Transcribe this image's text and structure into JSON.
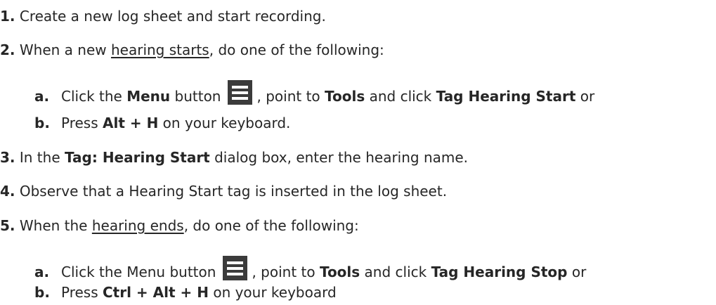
{
  "steps": {
    "s1": {
      "num": "1.",
      "text": " Create a new log sheet and start recording."
    },
    "s2": {
      "num": "2.",
      "pre": " When a new ",
      "link": "hearing starts",
      "post": ", do one of the following:",
      "a": {
        "letter": "a.",
        "t1": "Click the ",
        "b1": "Menu",
        "t2": " button",
        "t3": ", point to ",
        "b2": "Tools",
        "t4": " and click ",
        "b3": "Tag Hearing Start",
        "t5": " or"
      },
      "b": {
        "letter": "b.",
        "t1": "Press ",
        "b1": "Alt + H",
        "t2": " on your keyboard."
      }
    },
    "s3": {
      "num": "3.",
      "pre": " In the ",
      "bold": "Tag: Hearing Start",
      "post": " dialog box, enter the hearing name."
    },
    "s4": {
      "num": "4.",
      "text": " Observe that a Hearing Start tag is inserted in the log sheet."
    },
    "s5": {
      "num": "5.",
      "pre": " When the ",
      "link": "hearing ends",
      "post": ", do one of the following:",
      "a": {
        "letter": "a.",
        "t1": "Click the Menu button",
        "t2": ", point to ",
        "b1": "Tools",
        "t3": " and click ",
        "b2": "Tag Hearing Stop",
        "t4": " or"
      },
      "b": {
        "letter": "b.",
        "t1": "Press ",
        "b1": "Ctrl + Alt + H",
        "t2": " on your keyboard"
      }
    }
  },
  "icons": {
    "menu": "hamburger-menu-icon"
  },
  "colors": {
    "text": "#262626",
    "icon_bg": "#3b3b3b",
    "icon_lines": "#ffffff"
  }
}
